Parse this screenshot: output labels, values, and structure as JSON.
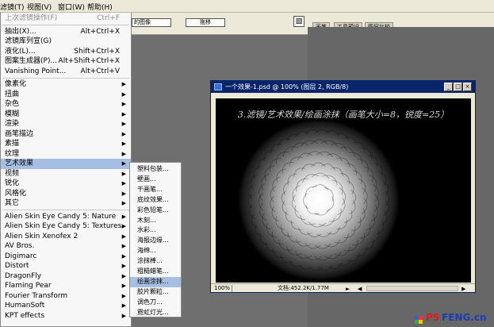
{
  "menubar": {
    "items": [
      "滤镜(T)",
      "视图(V)",
      "窗口(W)",
      "帮助(H)"
    ]
  },
  "optionsbar": {
    "button1": "的图像",
    "button2": "拖移",
    "tabs": [
      "画笔",
      "工具预设",
      "图层比较"
    ]
  },
  "menu": {
    "top_items": [
      {
        "label": "上次滤镜操作(F)",
        "shortcut": "Ctrl+F",
        "disabled": true
      },
      {
        "label": "抽出(X)...",
        "shortcut": "Alt+Ctrl+X"
      },
      {
        "label": "滤镜库列宣(G)",
        "shortcut": ""
      },
      {
        "label": "液化(L)...",
        "shortcut": "Shift+Ctrl+X"
      },
      {
        "label": "图案生成器(P)...",
        "shortcut": "Alt+Shift+Ctrl+X"
      },
      {
        "label": "Vanishing Point...",
        "shortcut": "Alt+Ctrl+V"
      }
    ],
    "filter_groups": [
      "像素化",
      "扭曲",
      "杂色",
      "模糊",
      "渲染",
      "画笔描边",
      "素描",
      "纹理",
      "艺术效果",
      "视频",
      "锐化",
      "风格化",
      "其它"
    ],
    "highlighted": "艺术效果",
    "plugins": [
      "Alien Skin Eye Candy 5: Nature",
      "Alien Skin Eye Candy 5: Textures",
      "Alien Skin Xenofex 2",
      "AV Bros.",
      "Digimarc",
      "Distort",
      "DragonFly",
      "Flaming Pear",
      "Fourier Transform",
      "HumanSoft",
      "KPT effects"
    ]
  },
  "submenu": {
    "items": [
      "塑料包装...",
      "壁画...",
      "干画笔...",
      "底纹效果...",
      "彩色铅笔...",
      "木刻...",
      "水彩...",
      "海报边缘...",
      "海绵...",
      "涂抹棒...",
      "粗糙蜡笔...",
      "绘画涂抹...",
      "胶片颗粒...",
      "调色刀...",
      "霓虹灯光..."
    ],
    "highlighted": "绘画涂抹..."
  },
  "document": {
    "title": "一个效果-1.psd @ 100% (图层 2, RGB/8)",
    "caption": "3.滤镜/艺术效果/绘画涂抹（画笔大小=8，锐度=25）",
    "zoom": "100%",
    "doc_size": "文档:452.2K/1.77M"
  },
  "watermark": {
    "left": "PS",
    "right": "FENG.cn",
    "color_left": "#d81e1e",
    "color_right": "#1b3fb0"
  },
  "colors": {
    "menu_highlight": "#a7bee3",
    "title_bar": "#0a246a"
  }
}
